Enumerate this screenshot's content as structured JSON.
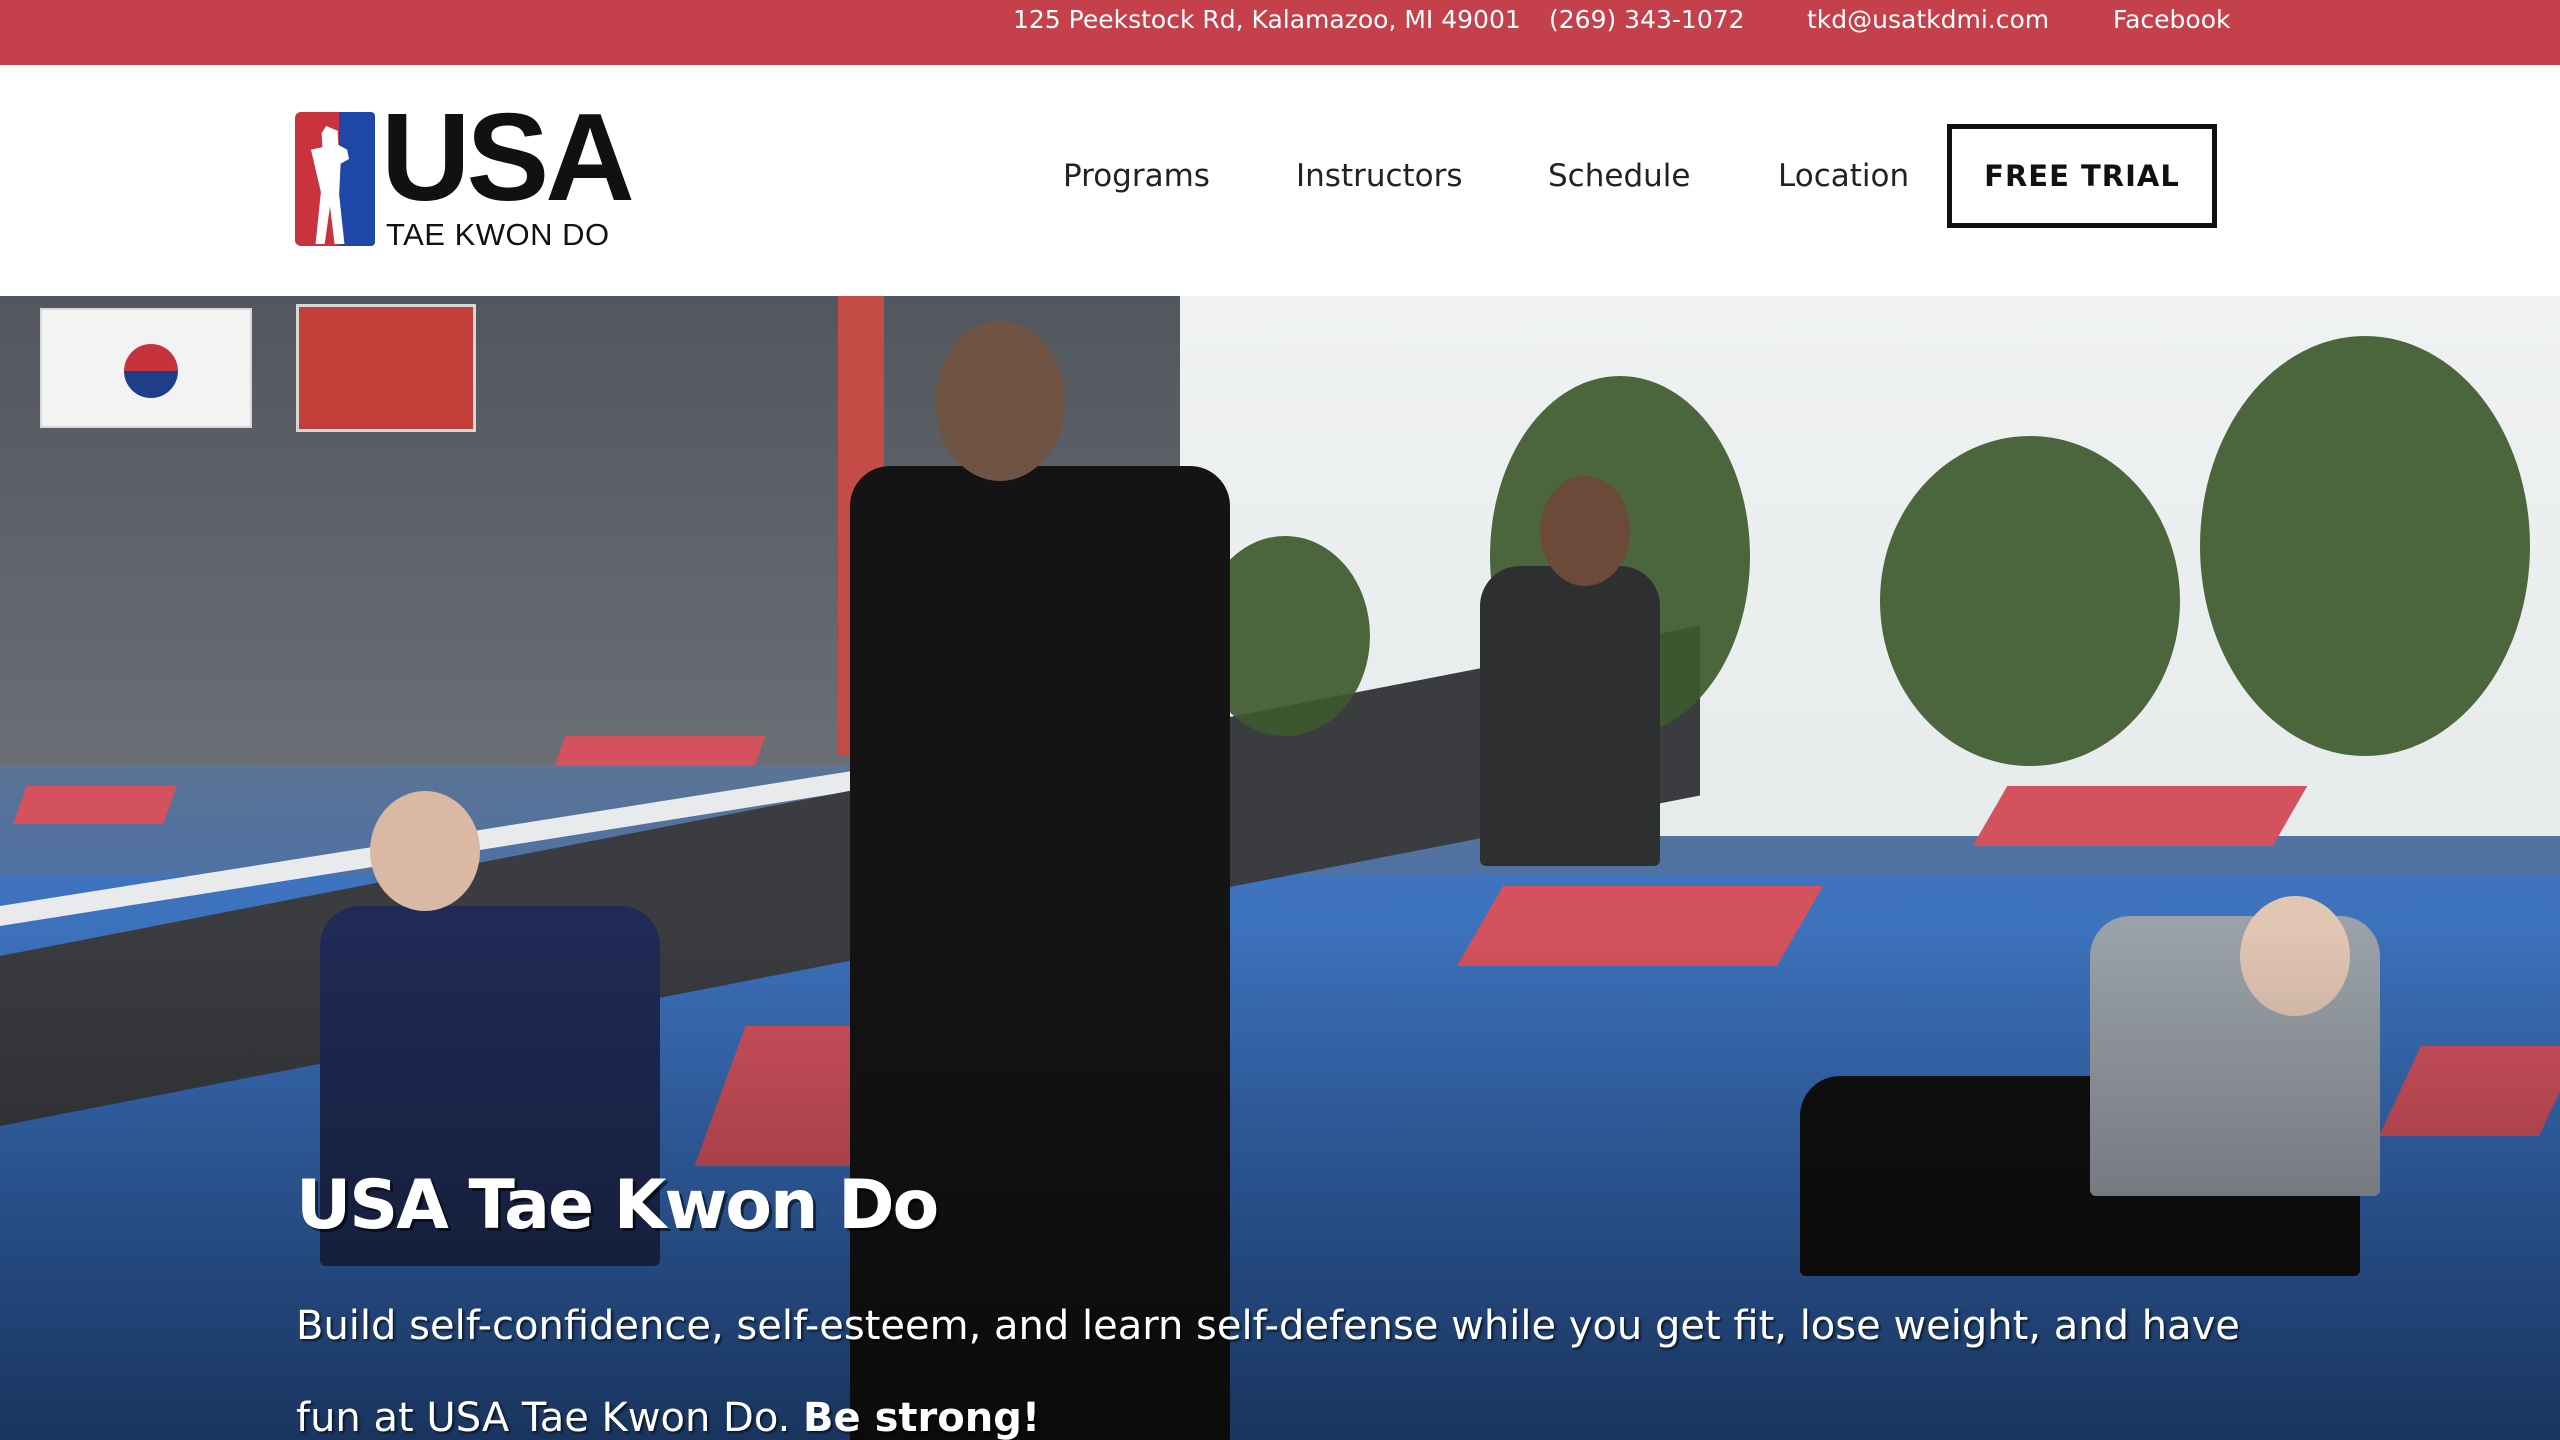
{
  "topbar": {
    "address": "125 Peekstock Rd, Kalamazoo, MI 49001",
    "phone": "(269) 343-1072",
    "email": "tkd@usatkdmi.com",
    "facebook": "Facebook"
  },
  "logo": {
    "line1": "USA",
    "line2": "TAE KWON DO"
  },
  "nav": {
    "items": [
      {
        "label": "Programs"
      },
      {
        "label": "Instructors"
      },
      {
        "label": "Schedule"
      },
      {
        "label": "Location"
      }
    ],
    "cta": "FREE TRIAL"
  },
  "hero": {
    "title": "USA Tae Kwon Do",
    "text": "Build self-confidence, self-esteem, and learn self-defense while you get fit, lose weight, and have fun at USA Tae Kwon Do.",
    "text_bold": "Be strong!"
  },
  "colors": {
    "topbar": "#c4404a",
    "logo_red": "#c9333d",
    "logo_blue": "#1f47a8",
    "floor_blue": "#2f60aa",
    "mat_red": "#d4525e"
  }
}
